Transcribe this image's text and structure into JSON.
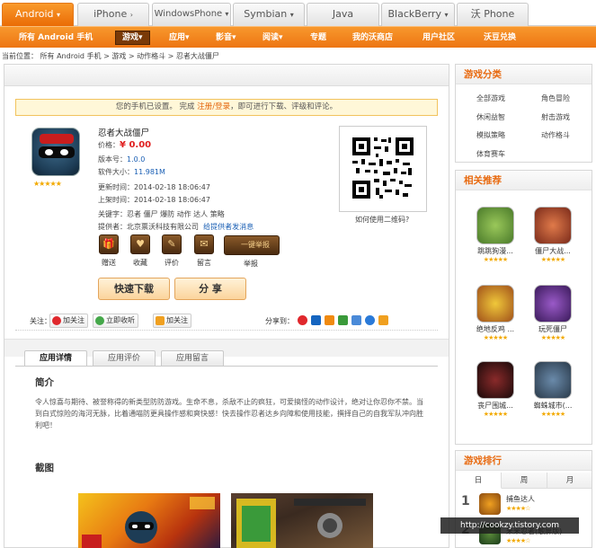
{
  "platform_tabs": [
    {
      "label": "Android",
      "arrow": "▾",
      "active": true
    },
    {
      "label": "iPhone",
      "arrow": "›",
      "active": false
    },
    {
      "label": "WindowsPhone",
      "arrow": "▾",
      "active": false
    },
    {
      "label": "Symbian",
      "arrow": "▾",
      "active": false
    },
    {
      "label": "Java",
      "arrow": "",
      "active": false
    },
    {
      "label": "BlackBerry",
      "arrow": "▾",
      "active": false
    },
    {
      "label": "沃 Phone",
      "arrow": "",
      "active": false
    }
  ],
  "nav": {
    "items": [
      "所有 Android 手机",
      "游戏▾",
      "应用▾",
      "影音▾",
      "阅读▾",
      "专题",
      "我的沃商店",
      "用户社区",
      "沃豆兑换"
    ],
    "selected_index": 1
  },
  "breadcrumb": "当前位置： 所有 Android 手机 > 游戏 > 动作格斗 > 忍者大战僵尸",
  "notice": {
    "before": "您的手机已设置。 完成 ",
    "link": "注册/登录",
    "after": "，即可进行下载、评级和评论。"
  },
  "app": {
    "name": "忍者大战僵尸",
    "stars": "★★★★★",
    "price_label": "价格：",
    "price": "¥ 0.00",
    "version_label": "版本号：",
    "version": "1.0.0",
    "size_label": "软件大小：",
    "size": "11.981M",
    "updated_label": "更新时间：",
    "updated": "2014-02-18 18:06:47",
    "listed_label": "上架时间：",
    "listed": "2014-02-18 18:06:47",
    "keywords_label": "关键字：",
    "keywords": "忍者 僵尸 爆防 动作 达人 策略",
    "provider_label": "提供者：",
    "provider": "北京票沃科技有限公司",
    "provider_link": "给提供者发消息"
  },
  "qr_hint": "如何使用二维码?",
  "actions": [
    {
      "label": "赠送",
      "icon": "gift-icon",
      "glyph": "🎁"
    },
    {
      "label": "收藏",
      "icon": "favorite-icon",
      "glyph": "♥"
    },
    {
      "label": "评价",
      "icon": "rate-icon",
      "glyph": "✎"
    },
    {
      "label": "留言",
      "icon": "message-icon",
      "glyph": "✉"
    }
  ],
  "report": {
    "button": "一键举报",
    "label": "举报"
  },
  "buttons": {
    "download": "快速下载",
    "share": "分 享"
  },
  "follow": {
    "label": "关注：",
    "weibo": "加关注",
    "qzone": "立即收听",
    "tencent": "加关注",
    "share_label": "分享到："
  },
  "detail_tabs": [
    "应用详情",
    "应用评价",
    "应用留言"
  ],
  "intro_title": "简介",
  "intro_text": "令人惊喜与期待、被誉称得的新类型防防游戏。生命不息，杀敌不止的疯狂，可爱搞怪的动作设计，绝对让你忍你不禁。当到白式惊险的海河无脉，比着通喵防更具操作感和爽快感！快去操作忍者达乡向障和使用技能，撰择自己的自我军队冲向胜利吧！",
  "screens_title": "截图",
  "sidebar": {
    "categories_title": "游戏分类",
    "categories": [
      "全部游戏",
      "角色冒险",
      "休闲益智",
      "射击游戏",
      "模拟策略",
      "动作格斗",
      "体育赛车"
    ],
    "recommend_title": "相关推荐",
    "recommend": [
      {
        "name": "跳跳狗漫...",
        "stars": "★★★★★",
        "color": "#6a9a3a"
      },
      {
        "name": "僵尸大战...",
        "stars": "★★★★★",
        "color": "#c84a2a"
      },
      {
        "name": "绝地反鸡 ...",
        "stars": "★★★★★",
        "color": "#d8a020"
      },
      {
        "name": "玩死僵尸",
        "stars": "★★★★★",
        "color": "#6a2a8a"
      },
      {
        "name": "丧尸围城...",
        "stars": "★★★★★",
        "color": "#5a1a1a"
      },
      {
        "name": "蜘蛛城市(...",
        "stars": "★★★★★",
        "color": "#3a5a7a"
      }
    ],
    "rank_title": "游戏排行",
    "rank_tabs": [
      "日",
      "周",
      "月"
    ],
    "rank": [
      {
        "no": "1",
        "name": "捕鱼达人",
        "stars": "★★★★☆"
      },
      {
        "no": "2",
        "name": "米米忍者(触屏版)",
        "stars": "★★★★☆"
      }
    ]
  },
  "watermark": "http://cookzy.tistory.com"
}
